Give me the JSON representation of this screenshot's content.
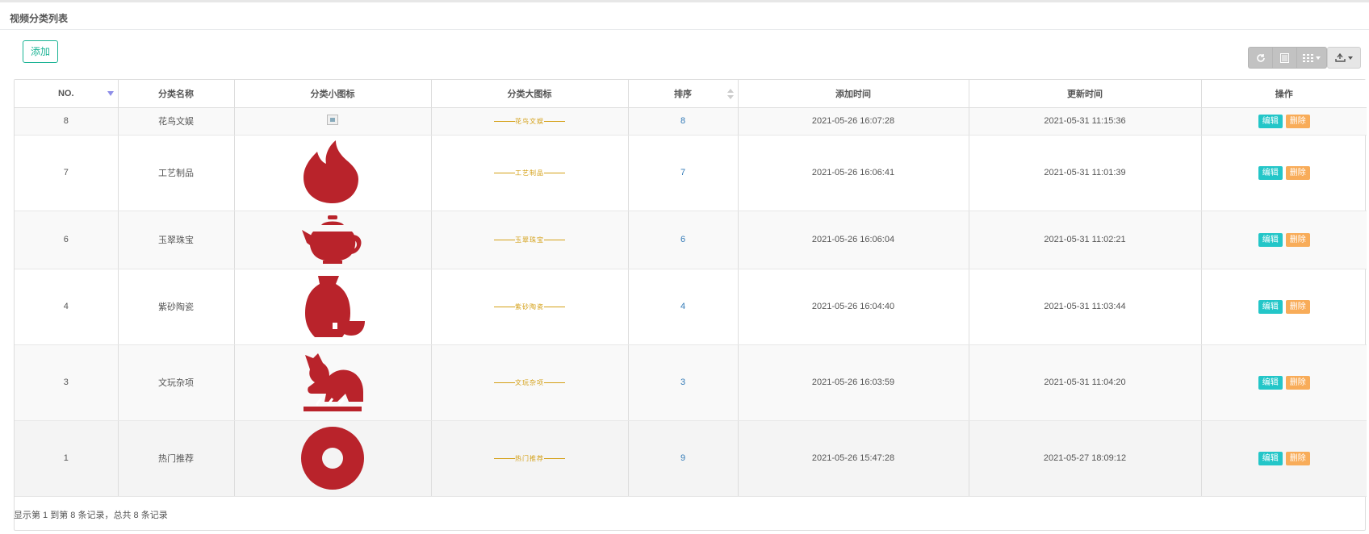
{
  "page": {
    "title": "视频分类列表"
  },
  "toolbar": {
    "add_label": "添加",
    "buttons": [
      "refresh-icon",
      "toggle-view-icon",
      "columns-icon",
      "export-icon"
    ]
  },
  "table": {
    "columns": [
      "NO.",
      "分类名称",
      "分类小图标",
      "分类大图标",
      "排序",
      "添加时间",
      "更新时间",
      "操作"
    ],
    "rows": [
      {
        "no": "8",
        "name": "花鸟文娱",
        "small_icon": "broken-image-icon",
        "banner": "花鸟文娱",
        "sort": "8",
        "created": "2021-05-26 16:07:28",
        "updated": "2021-05-31 11:15:36",
        "edit": "编辑",
        "delete": "删除"
      },
      {
        "no": "7",
        "name": "工艺制品",
        "small_icon": "flame-icon",
        "banner": "工艺制品",
        "sort": "7",
        "created": "2021-05-26 16:06:41",
        "updated": "2021-05-31 11:01:39",
        "edit": "编辑",
        "delete": "删除"
      },
      {
        "no": "6",
        "name": "玉翠珠宝",
        "small_icon": "teapot-icon",
        "banner": "玉翠珠宝",
        "sort": "6",
        "created": "2021-05-26 16:06:04",
        "updated": "2021-05-31 11:02:21",
        "edit": "编辑",
        "delete": "删除"
      },
      {
        "no": "4",
        "name": "紫砂陶瓷",
        "small_icon": "vase-icon",
        "banner": "紫砂陶瓷",
        "sort": "4",
        "created": "2021-05-26 16:04:40",
        "updated": "2021-05-31 11:03:44",
        "edit": "编辑",
        "delete": "删除"
      },
      {
        "no": "3",
        "name": "文玩杂项",
        "small_icon": "beast-icon",
        "banner": "文玩杂项",
        "sort": "3",
        "created": "2021-05-26 16:03:59",
        "updated": "2021-05-31 11:04:20",
        "edit": "编辑",
        "delete": "删除"
      },
      {
        "no": "1",
        "name": "热门推荐",
        "small_icon": "ring-icon",
        "banner": "热门推荐",
        "sort": "9",
        "created": "2021-05-26 15:47:28",
        "updated": "2021-05-27 18:09:12",
        "edit": "编辑",
        "delete": "删除"
      }
    ]
  },
  "pagination": {
    "summary": "显示第 1 到第 8 条记录，总共 8 条记录"
  },
  "colors": {
    "accent": "#1ab394",
    "icon_red": "#b9232b",
    "banner_gold": "#d4a017",
    "edit": "#23c6c8",
    "delete": "#f8ac59",
    "link": "#337ab7"
  }
}
